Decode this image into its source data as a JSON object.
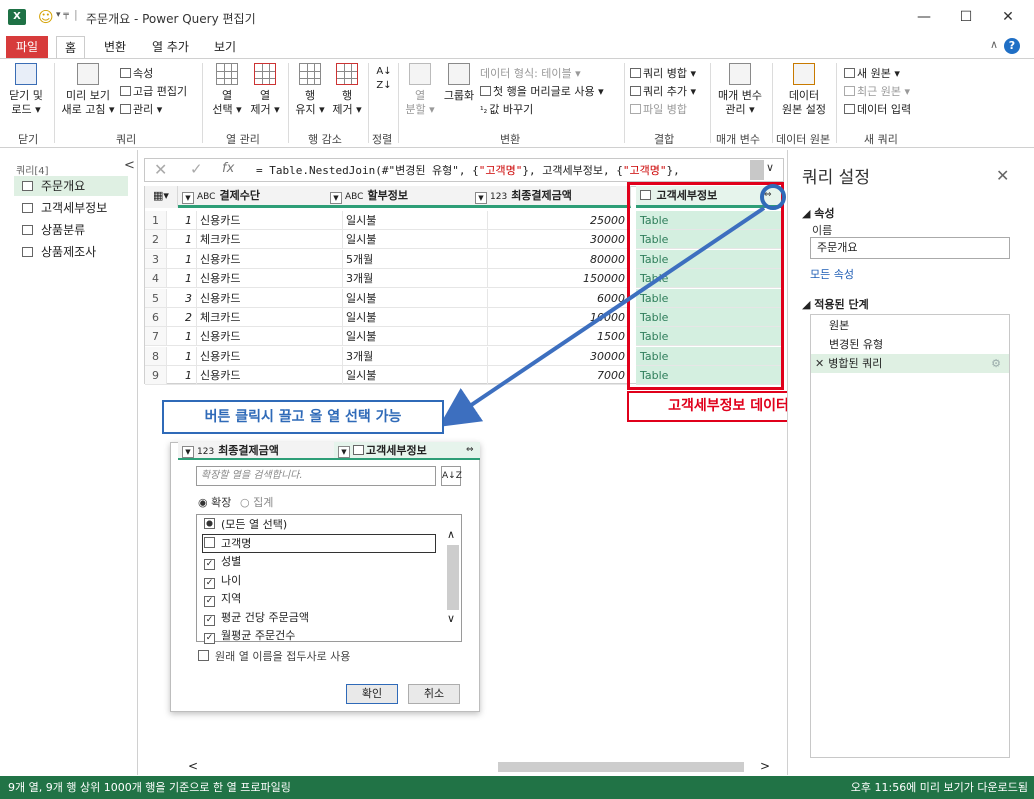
{
  "window": {
    "title": "주문개요 - Power Query 편집기",
    "qat_dropdown": "▾ ╤",
    "minimize": "—",
    "maximize": "☐",
    "close": "✕",
    "excel_badge": "X"
  },
  "tabs": [
    "파일",
    "홈",
    "변환",
    "열 추가",
    "보기"
  ],
  "ribbon": {
    "close_load": [
      "닫기 및",
      "로드 ▾"
    ],
    "refresh_preview": [
      "미리 보기",
      "새로 고침 ▾"
    ],
    "properties": "속성",
    "advanced_editor": "고급 편집기",
    "manage": "관리 ▾",
    "choose_columns": [
      "열",
      "선택 ▾"
    ],
    "remove_columns": [
      "열",
      "제거 ▾"
    ],
    "keep_rows": [
      "행",
      "유지 ▾"
    ],
    "remove_rows": [
      "행",
      "제거 ▾"
    ],
    "split_column": [
      "열",
      "분할 ▾"
    ],
    "group_by": "그룹화",
    "data_type": "데이터 형식: 테이블 ▾",
    "first_row_header": "첫 행을 머리글로 사용 ▾",
    "replace_values": "값 바꾸기",
    "merge_queries": "쿼리 병합 ▾",
    "append_queries": "쿼리 추가 ▾",
    "combine_files": "파일 병합",
    "manage_params": [
      "매개 변수",
      "관리 ▾"
    ],
    "data_source": [
      "데이터",
      "원본 설정"
    ],
    "new_source": "새 원본 ▾",
    "recent_sources": "최근 원본 ▾",
    "enter_data": "데이터 입력",
    "groups": [
      "닫기",
      "쿼리",
      "열 관리",
      "행 감소",
      "정렬",
      "변환",
      "결합",
      "매개 변수",
      "데이터 원본",
      "새 쿼리"
    ]
  },
  "left_pane": {
    "header": "쿼리[4]",
    "collapse": "<",
    "queries": [
      "주문개요",
      "고객세부정보",
      "상품분류",
      "상품제조사"
    ],
    "selected": 0
  },
  "formula_bar": {
    "prefix": "= Table.NestedJoin(#\"변경된 유형\", {",
    "s1": "\"고객명\"",
    "mid": "}, 고객세부정보, {",
    "s2": "\"고객명\"",
    "suffix": "},",
    "expand": "∨"
  },
  "grid": {
    "columns": [
      {
        "type": "ABC",
        "name": "결제수단"
      },
      {
        "type": "ABC",
        "name": "할부정보"
      },
      {
        "type": "123",
        "name": "최종결제금액"
      },
      {
        "type": "table",
        "name": "고객세부정보"
      }
    ],
    "rows": [
      {
        "n": "1",
        "lead": "1",
        "pay": "신용카드",
        "inst": "일시불",
        "amount": "25000",
        "detail": "Table"
      },
      {
        "n": "2",
        "lead": "1",
        "pay": "체크카드",
        "inst": "일시불",
        "amount": "30000",
        "detail": "Table"
      },
      {
        "n": "3",
        "lead": "1",
        "pay": "신용카드",
        "inst": "5개월",
        "amount": "80000",
        "detail": "Table"
      },
      {
        "n": "4",
        "lead": "1",
        "pay": "신용카드",
        "inst": "3개월",
        "amount": "150000",
        "detail": "Table"
      },
      {
        "n": "5",
        "lead": "3",
        "pay": "신용카드",
        "inst": "일시불",
        "amount": "6000",
        "detail": "Table"
      },
      {
        "n": "6",
        "lead": "2",
        "pay": "체크카드",
        "inst": "일시불",
        "amount": "10000",
        "detail": "Table"
      },
      {
        "n": "7",
        "lead": "1",
        "pay": "신용카드",
        "inst": "일시불",
        "amount": "1500",
        "detail": "Table"
      },
      {
        "n": "8",
        "lead": "1",
        "pay": "신용카드",
        "inst": "3개월",
        "amount": "30000",
        "detail": "Table"
      },
      {
        "n": "9",
        "lead": "1",
        "pay": "신용카드",
        "inst": "일시불",
        "amount": "7000",
        "detail": "Table"
      }
    ]
  },
  "annotations": {
    "red": "고객세부정보 데이터를 끌고 온 상태",
    "blue": "버튼 클릭시 끌고 올 열 선택 가능",
    "red_color": "#e0001b",
    "blue_color": "#2f6ab8"
  },
  "expand_dialog": {
    "col1_type": "123",
    "col1_name": "최종결제금액",
    "col2_name": "고객세부정보",
    "search_placeholder": "확장할 열을 검색합니다.",
    "sort": "A↓Z",
    "radio_expand": "확장",
    "radio_aggregate": "집계",
    "options": [
      {
        "label": "(모든 열 선택)",
        "state": "partial"
      },
      {
        "label": "고객명",
        "state": "unchecked"
      },
      {
        "label": "성별",
        "state": "checked"
      },
      {
        "label": "나이",
        "state": "checked"
      },
      {
        "label": "지역",
        "state": "checked"
      },
      {
        "label": "평균 건당 주문금액",
        "state": "checked"
      },
      {
        "label": "월평균 주문건수",
        "state": "checked"
      }
    ],
    "prefix_option": "원래 열 이름을 접두사로 사용",
    "ok": "확인",
    "cancel": "취소"
  },
  "right_pane": {
    "title": "쿼리 설정",
    "close": "✕",
    "properties_header": "◢ 속성",
    "name_label": "이름",
    "name_value": "주문개요",
    "all_properties": "모든 속성",
    "steps_header": "◢ 적용된 단계",
    "steps": [
      "원본",
      "변경된 유형",
      "병합된 쿼리"
    ],
    "selected_step": 2,
    "step_delete": "✕",
    "step_gear": "⚙"
  },
  "status": {
    "left": "9개 열, 9개 행   상위 1000개 행을 기준으로 한 열 프로파일링",
    "right": "오후 11:56에 미리 보기가 다운로드됨"
  },
  "colors": {
    "accent_green": "#217346",
    "file_tab": "#d73b3b",
    "table_cell": "#d4efe0"
  }
}
